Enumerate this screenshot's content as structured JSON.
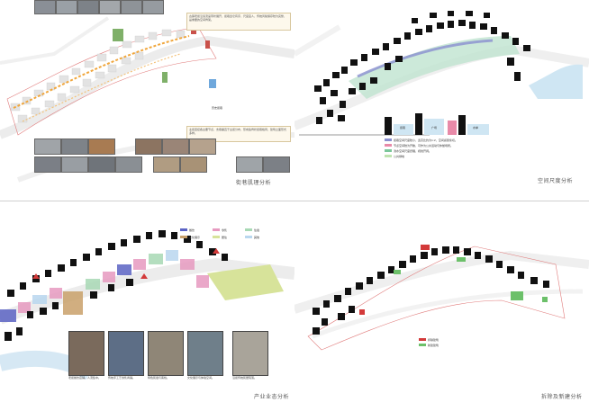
{
  "panels": {
    "street_analysis": {
      "title": "街巷肌理分析",
      "center_label": "历史街巷",
      "note_top": "古镇老街沿溪流呈带状展开，街巷宽窄有序，尺度宜人，传统风貌保存较为完整，是重要的空间骨架。",
      "note_bottom": "主街连接各主要节点，支巷垂直于主街分布，形成鱼骨状街巷格局，建筑立面形式多样。"
    },
    "space_scale": {
      "title": "空间尺度分析",
      "section_labels": [
        "街巷",
        "广场",
        "水岸"
      ],
      "legend": [
        {
          "label": "街巷空间尺度较小，宽高比约为1:2，空间感受亲切。",
          "color": "#8a8fcf"
        },
        {
          "label": "节点空间较为开敞，可作为公共活动与休憩场所。",
          "color": "#e88aa8"
        },
        {
          "label": "滨水空间尺度舒展，视线开阔。",
          "color": "#7bc79a"
        },
        {
          "label": "公共绿地",
          "color": "#bfe3b0"
        }
      ]
    },
    "industry": {
      "title": "产业业态分析",
      "legend": [
        {
          "label": "餐饮",
          "color": "#5b63c4"
        },
        {
          "label": "零售",
          "color": "#e79ac0"
        },
        {
          "label": "住宿",
          "color": "#a8d9b5"
        },
        {
          "label": "文化展示",
          "color": "#c9a16a"
        },
        {
          "label": "居住",
          "color": "#d7e39a"
        },
        {
          "label": "其他",
          "color": "#b9d7ef"
        }
      ],
      "captions": [
        "老街餐饮店铺，人流集中。",
        "传统手工艺零售商铺。",
        "特色民宿与客栈。",
        "文化展示与体验空间。",
        "沿街传统民居院落。"
      ]
    },
    "demolition": {
      "title": "拆除及新建分析",
      "legend": [
        {
          "label": "拆除建筑",
          "color": "#d33a3a"
        },
        {
          "label": "新建建筑",
          "color": "#6cc06a"
        }
      ]
    }
  },
  "colors": {
    "buildings": "#111111",
    "road": "#e6e6e6",
    "boundary": "#e07a7a",
    "water": "#cfe6f3"
  }
}
